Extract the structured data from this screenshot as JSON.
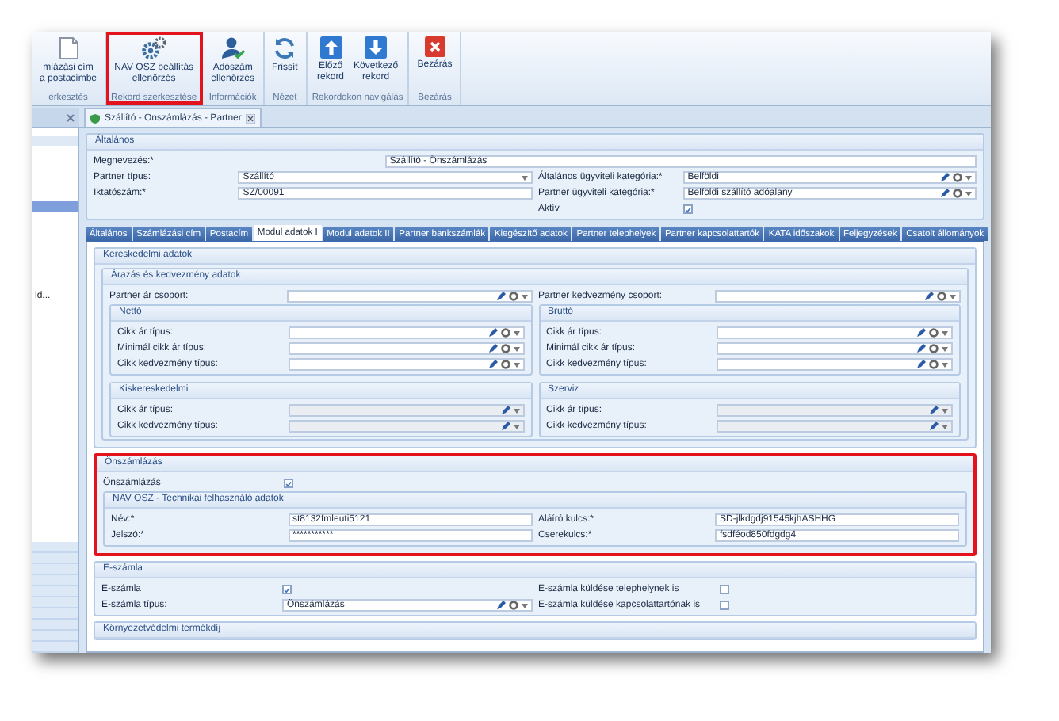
{
  "ribbon": {
    "groups": [
      {
        "label": "erkesztés",
        "highlighted": false,
        "buttons": [
          {
            "label": "mlázási cím\na postacímbe",
            "kind": "document"
          }
        ]
      },
      {
        "label": "Rekord szerkesztése",
        "highlighted": true,
        "buttons": [
          {
            "label": "NAV OSZ beállítás\nellenőrzés",
            "kind": "gears"
          }
        ]
      },
      {
        "label": "Információk",
        "highlighted": false,
        "buttons": [
          {
            "label": "Adószám\nellenőrzés",
            "kind": "user-check"
          }
        ]
      },
      {
        "label": "Nézet",
        "highlighted": false,
        "buttons": [
          {
            "label": "Frissít",
            "kind": "refresh"
          }
        ]
      },
      {
        "label": "Rekordokon navigálás",
        "highlighted": false,
        "buttons": [
          {
            "label": "Előző\nrekord",
            "kind": "up"
          },
          {
            "label": "Következő\nrekord",
            "kind": "down"
          }
        ]
      },
      {
        "label": "Bezárás",
        "highlighted": false,
        "buttons": [
          {
            "label": "Bezárás",
            "kind": "close"
          }
        ]
      }
    ]
  },
  "document_tabs": [
    {
      "title": "Szállító - Önszámlázás - Partner",
      "selected": true
    }
  ],
  "sidebar": {
    "items": [
      {
        "selected": true
      },
      {
        "label": "ld...",
        "selected": false
      }
    ]
  },
  "general": {
    "title": "Általános",
    "rows": [
      {
        "full": {
          "label": "Megnevezés:*",
          "kind": "text",
          "value": "Szállító - Önszámlázás"
        }
      },
      {
        "left": {
          "label": "Partner típus:",
          "kind": "select",
          "value": "Szállító"
        },
        "right": {
          "label": "Általános ügyviteli kategória:*",
          "kind": "lookup",
          "value": "Belföldi"
        }
      },
      {
        "left": {
          "label": "Iktatószám:*",
          "kind": "text",
          "value": "SZ/00091"
        },
        "right": {
          "label": "Partner ügyviteli kategória:*",
          "kind": "lookup",
          "value": "Belföldi szállító adóalany"
        }
      },
      {
        "right": {
          "label": "Aktív",
          "kind": "checkbox",
          "checked": true
        }
      }
    ]
  },
  "tabs": [
    {
      "label": "Általános",
      "selected": false
    },
    {
      "label": "Számlázási cím",
      "selected": false
    },
    {
      "label": "Postacím",
      "selected": false
    },
    {
      "label": "Modul adatok I",
      "selected": true
    },
    {
      "label": "Modul adatok II",
      "selected": false
    },
    {
      "label": "Partner bankszámlák",
      "selected": false
    },
    {
      "label": "Kiegészítő adatok",
      "selected": false
    },
    {
      "label": "Partner telephelyek",
      "selected": false
    },
    {
      "label": "Partner kapcsolattartók",
      "selected": false
    },
    {
      "label": "KATA időszakok",
      "selected": false
    },
    {
      "label": "Feljegyzések",
      "selected": false
    },
    {
      "label": "Csatolt állományok",
      "selected": false
    }
  ],
  "sections": [
    {
      "title": "Kereskedelmi adatok",
      "highlighted": false,
      "subsections": [
        {
          "title": "Árazás és kedvezmény adatok",
          "rows": [
            {
              "left": {
                "label": "Partner ár csoport:",
                "kind": "lookup"
              },
              "right": {
                "label": "Partner kedvezmény csoport:",
                "kind": "lookup"
              }
            }
          ],
          "groups": [
            {
              "title": "Nettó",
              "rows": [
                {
                  "left": {
                    "label": "Cikk ár típus:",
                    "kind": "lookup"
                  }
                },
                {
                  "left": {
                    "label": "Minimál cikk ár típus:",
                    "kind": "lookup"
                  }
                },
                {
                  "left": {
                    "label": "Cikk kedvezmény típus:",
                    "kind": "lookup"
                  }
                }
              ]
            },
            {
              "title": "Bruttó",
              "rows": [
                {
                  "left": {
                    "label": "Cikk ár típus:",
                    "kind": "lookup"
                  }
                },
                {
                  "left": {
                    "label": "Minimál cikk ár típus:",
                    "kind": "lookup"
                  }
                },
                {
                  "left": {
                    "label": "Cikk kedvezmény típus:",
                    "kind": "lookup"
                  }
                }
              ]
            },
            {
              "title": "Kiskereskedelmi",
              "rows": [
                {
                  "left": {
                    "label": "Cikk ár típus:",
                    "kind": "readonly"
                  }
                },
                {
                  "left": {
                    "label": "Cikk kedvezmény típus:",
                    "kind": "readonly"
                  }
                }
              ]
            },
            {
              "title": "Szerviz",
              "rows": [
                {
                  "left": {
                    "label": "Cikk ár típus:",
                    "kind": "readonly"
                  }
                },
                {
                  "left": {
                    "label": "Cikk kedvezmény típus:",
                    "kind": "readonly"
                  }
                }
              ]
            }
          ]
        }
      ]
    },
    {
      "title": "Önszámlázás",
      "highlighted": true,
      "rows": [
        {
          "left": {
            "label": "Önszámlázás",
            "kind": "checkbox",
            "checked": true
          }
        }
      ],
      "subsections": [
        {
          "title": "NAV OSZ - Technikai felhasználó adatok",
          "rows": [
            {
              "left": {
                "label": "Név:*",
                "kind": "text",
                "value": "st8132fmleuti5121"
              },
              "right": {
                "label": "Aláíró kulcs:*",
                "kind": "text",
                "value": "SD-jlkdgdj91545kjhASHHG"
              }
            },
            {
              "left": {
                "label": "Jelszó:*",
                "kind": "text",
                "value": "***********"
              },
              "right": {
                "label": "Cserekulcs:*",
                "kind": "text",
                "value": "fsdféod850fdgdg4"
              }
            }
          ]
        }
      ]
    },
    {
      "title": "E-számla",
      "highlighted": false,
      "rows": [
        {
          "left": {
            "label": "E-számla",
            "kind": "checkbox",
            "checked": true
          },
          "right": {
            "label": "E-számla küldése telephelynek is",
            "kind": "checkbox",
            "checked": false
          }
        },
        {
          "left": {
            "label": "E-számla típus:",
            "kind": "lookup",
            "value": "Önszámlázás"
          },
          "right": {
            "label": "E-számla küldése kapcsolattartónak is",
            "kind": "checkbox",
            "checked": false
          }
        }
      ]
    },
    {
      "title": "Környezetvédelmi termékdíj",
      "highlighted": false
    }
  ]
}
